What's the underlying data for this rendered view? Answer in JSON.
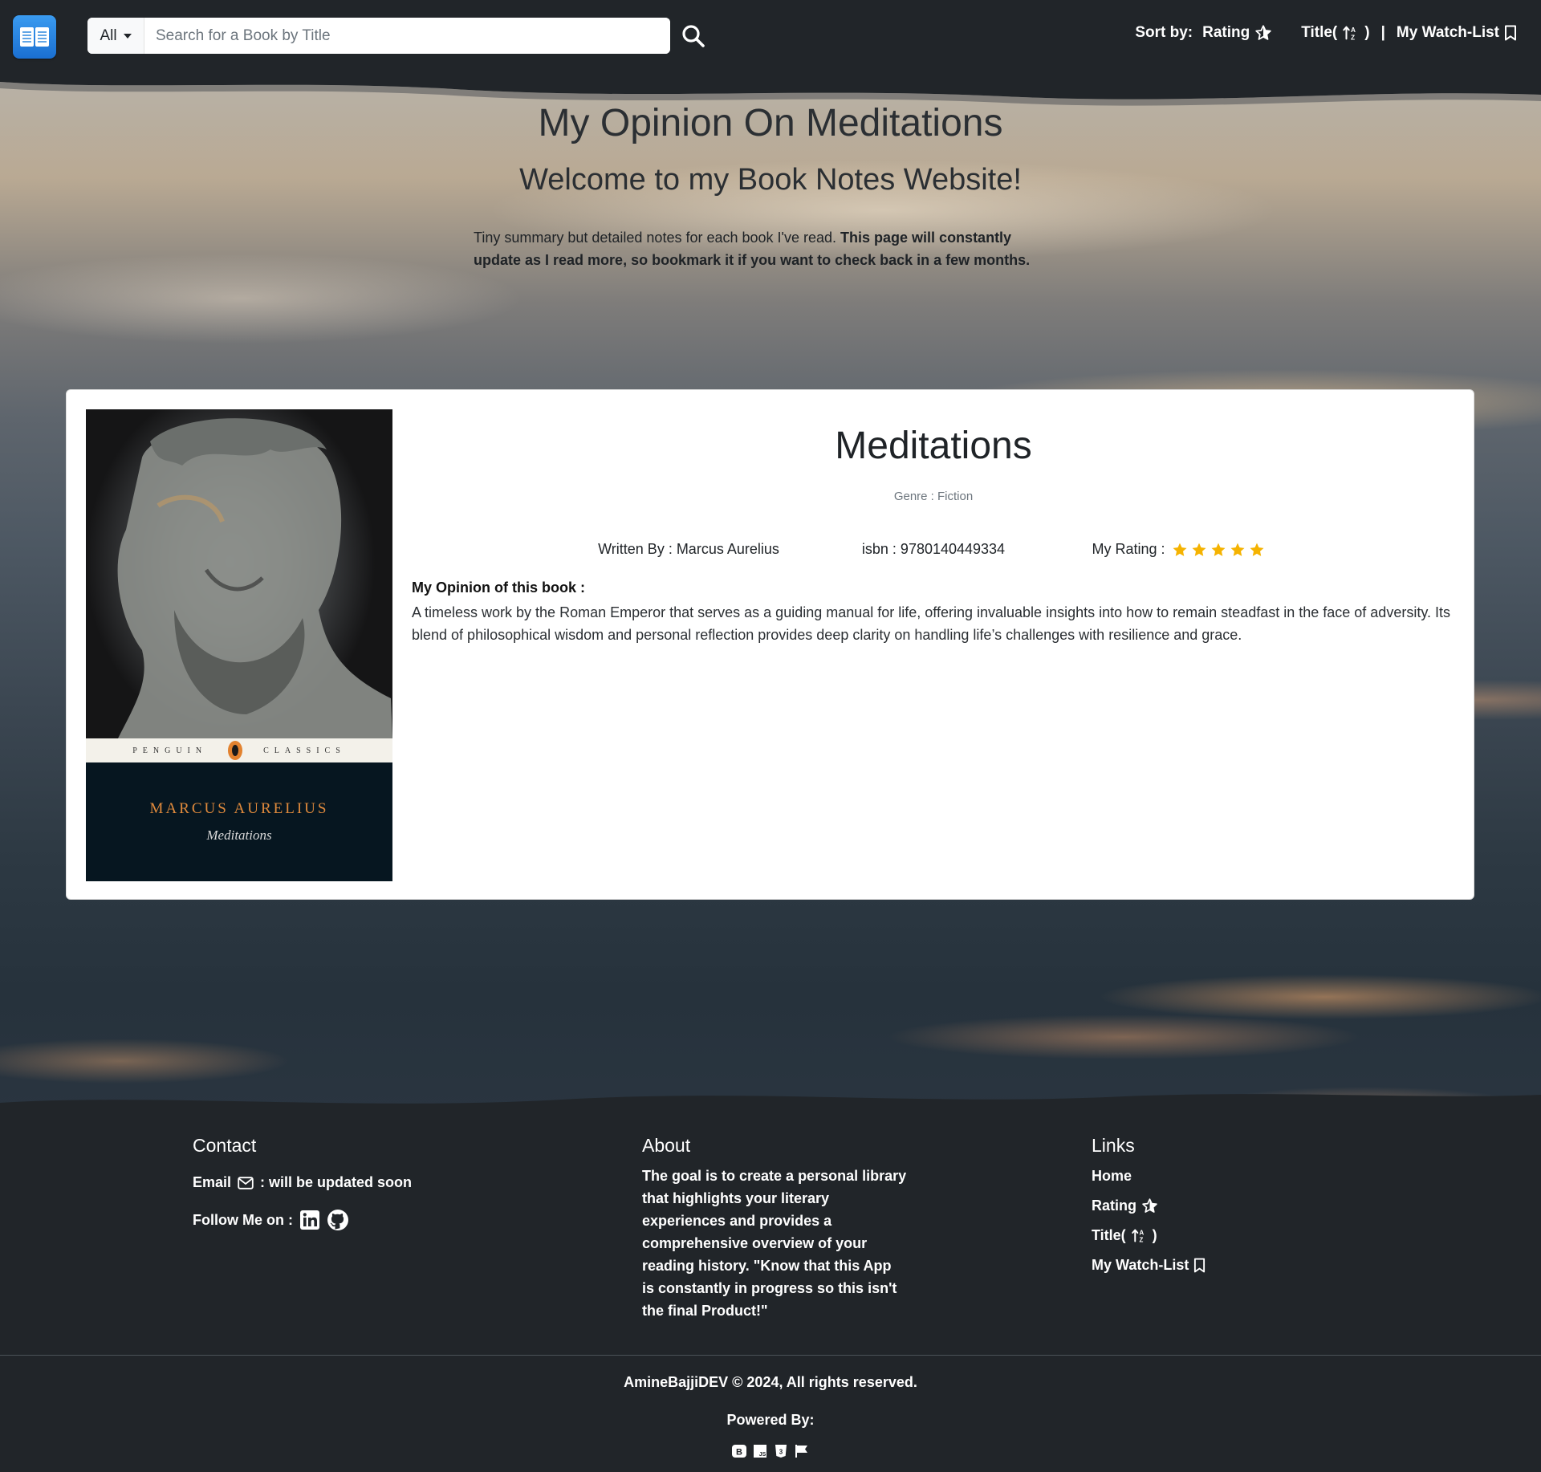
{
  "navbar": {
    "filter_label": "All",
    "search_placeholder": "Search for a Book by Title",
    "sort_label": "Sort by:",
    "sort_rating": "Rating",
    "sort_title": "Title(",
    "sort_title_close": ")",
    "separator": "|",
    "watchlist": "My Watch-List"
  },
  "hero": {
    "title": "My Opinion On Meditations",
    "subtitle": "Welcome to my Book Notes Website!",
    "intro_normal": "Tiny summary but detailed notes for each book I've read.",
    "intro_bold": "This page will constantly update as I read more, so bookmark it if you want to check back in a few months."
  },
  "book": {
    "title": "Meditations",
    "genre": "Genre : Fiction",
    "author_label": "Written By : Marcus Aurelius",
    "isbn_label": "isbn : 9780140449334",
    "rating_label": "My Rating :",
    "rating": 5,
    "rating_max": 5,
    "opinion_label": "My Opinion of this book :",
    "opinion_text": "A timeless work by the Roman Emperor that serves as a guiding manual for life, offering invaluable insights into how to remain steadfast in the face of adversity. Its blend of philosophical wisdom and personal reflection provides deep clarity on handling life’s challenges with resilience and grace.",
    "cover": {
      "band_left": "PENGUIN",
      "band_right": "CLASSICS",
      "author": "MARCUS AURELIUS",
      "title": "Meditations"
    }
  },
  "footer": {
    "contact_title": "Contact",
    "email_label": "Email",
    "email_value": ": will be updated soon",
    "follow_label": "Follow Me on :",
    "about_title": "About",
    "about_text": "The goal is to create a personal library that highlights your literary experiences and provides a comprehensive overview of your reading history. \"Know that this App is constantly in progress so this isn't the final Product!\"",
    "links_title": "Links",
    "links": {
      "home": "Home",
      "rating": "Rating",
      "title_open": "Title(",
      "title_close": ")",
      "watchlist": "My Watch-List"
    },
    "copyright": "AmineBajjiDEV © 2024, All rights reserved.",
    "powered_by": "Powered By:"
  },
  "colors": {
    "navbar_bg": "#212529",
    "star": "#f5b301",
    "logo": "#1a6fd1"
  }
}
